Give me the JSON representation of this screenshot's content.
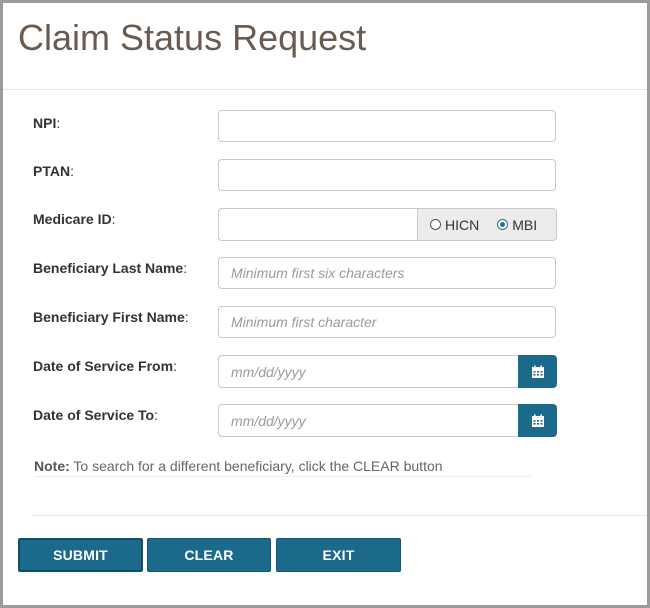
{
  "page": {
    "title": "Claim Status Request"
  },
  "form": {
    "npi": {
      "label": "NPI",
      "colon": ":",
      "value": "",
      "placeholder": ""
    },
    "ptan": {
      "label": "PTAN",
      "colon": ":",
      "value": "",
      "placeholder": ""
    },
    "medicare_id": {
      "label": "Medicare ID",
      "colon": ":",
      "value": "",
      "options": [
        {
          "label": "HICN",
          "checked": false
        },
        {
          "label": "MBI",
          "checked": true
        }
      ]
    },
    "last_name": {
      "label": "Beneficiary Last Name",
      "colon": ":",
      "value": "",
      "placeholder": "Minimum first six characters"
    },
    "first_name": {
      "label": "Beneficiary First Name",
      "colon": ":",
      "value": "",
      "placeholder": "Minimum first character"
    },
    "dos_from": {
      "label": "Date of Service From",
      "colon": ":",
      "value": "",
      "placeholder": "mm/dd/yyyy"
    },
    "dos_to": {
      "label": "Date of Service To",
      "colon": ":",
      "value": "",
      "placeholder": "mm/dd/yyyy"
    },
    "note": {
      "prefix": "Note:",
      "text": " To search for a different beneficiary, click the CLEAR button"
    }
  },
  "buttons": {
    "submit": "SUBMIT",
    "clear": "CLEAR",
    "exit": "EXIT"
  },
  "colors": {
    "accent": "#1c6a8b",
    "title": "#6b5a4e"
  },
  "icons": {
    "calendar": "calendar-icon"
  }
}
